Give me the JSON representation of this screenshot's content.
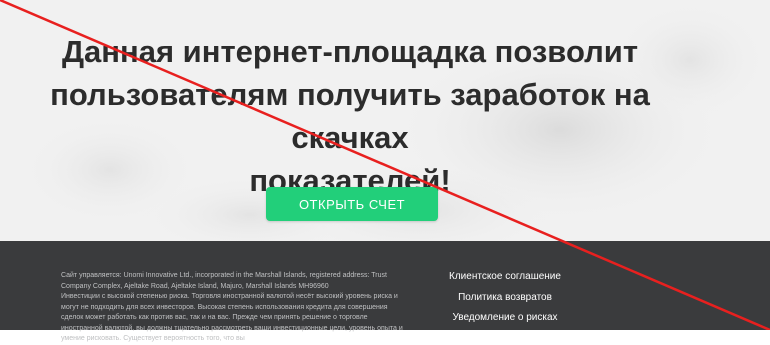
{
  "hero": {
    "headline_lines": [
      "Данная интернет-площадка позволит",
      "пользователям получить заработок на скачках",
      "показателей!"
    ],
    "cta_label": "ОТКРЫТЬ СЧЕТ",
    "cta_color": "#22cf7a",
    "background_color": "#f1f1f1"
  },
  "footer": {
    "background_color": "#3a3b3d",
    "legal": {
      "line1": "Сайт управляется: Unomi Innovative Ltd., incorporated in the Marshall Islands, registered address: Trust Company Complex, Ajeltake Road, Ajeltake Island, Majuro, Marshall Islands MH96960",
      "line2": "Инвестиции с высокой степенью риска. Торговля иностранной валютой несёт высокий уровень риска и могут не подходить для всех инвесторов. Высокая степень использования кредита для совершения сделок может работать как против вас, так и на вас. Прежде чем принять решение о торговле иностранной валютой, вы должны тщательно рассмотреть ваши инвестиционные цели, уровень опыта и умение рисковать. Существует вероятность того, что вы"
    },
    "links": [
      "Клиентское соглашение",
      "Политика возвратов",
      "Уведомление о рисках"
    ]
  },
  "overlay": {
    "strike_color": "#e8201f"
  }
}
